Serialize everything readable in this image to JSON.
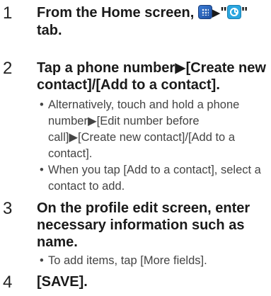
{
  "steps": [
    {
      "number": "1",
      "title_part1": "From the Home screen, ",
      "title_part2": "\"",
      "title_part3": "\"",
      "title_part4": "tab.",
      "arrow": "▶",
      "icon_apps": "apps-icon",
      "icon_clock": "call-log-icon"
    },
    {
      "number": "2",
      "title": "Tap a phone number▶[Create new contact]/[Add to a contact].",
      "bullets": [
        "Alternatively, touch and hold a phone number▶[Edit number before call]▶[Create new contact]/[Add to a contact].",
        "When you tap [Add to a contact], select a contact to add."
      ]
    },
    {
      "number": "3",
      "title": "On the profile edit screen, enter necessary information such as name.",
      "bullets": [
        "To add items, tap [More fields]."
      ]
    },
    {
      "number": "4",
      "title": "[SAVE]."
    }
  ]
}
